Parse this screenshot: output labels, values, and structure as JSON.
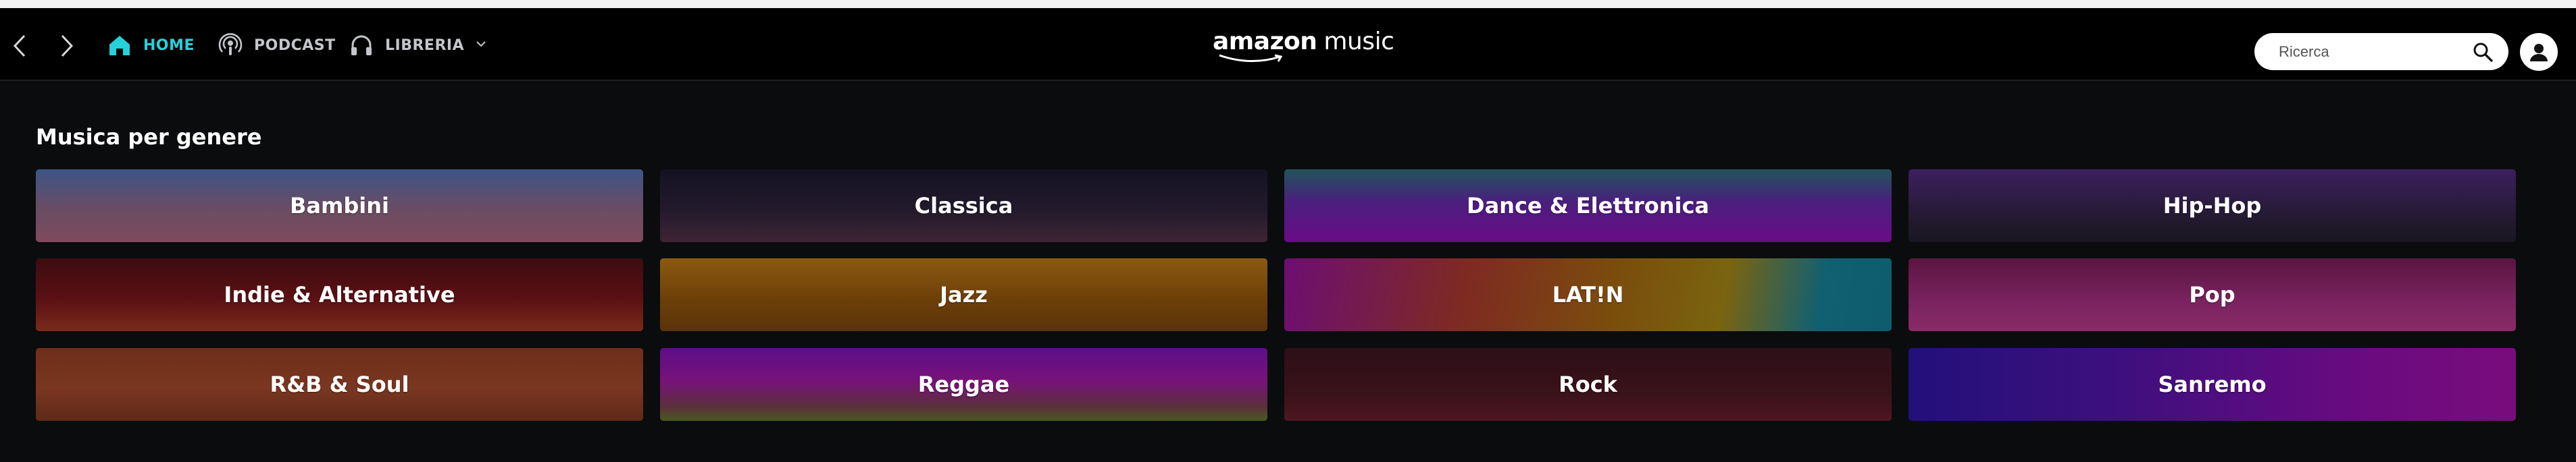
{
  "app": {
    "logo_text_left": "amazon",
    "logo_text_right": "music"
  },
  "nav": {
    "back_icon": "chevron-left-icon",
    "forward_icon": "chevron-right-icon",
    "items": [
      {
        "label": "HOME",
        "icon": "home-icon",
        "active": true
      },
      {
        "label": "PODCAST",
        "icon": "podcast-icon",
        "active": false
      },
      {
        "label": "LIBRERIA",
        "icon": "headphones-icon",
        "active": false
      }
    ]
  },
  "search": {
    "placeholder": "Ricerca",
    "value": "",
    "icon": "search-icon"
  },
  "profile": {
    "icon": "user-icon"
  },
  "section": {
    "title": "Musica per genere",
    "genres": [
      {
        "label": "Bambini"
      },
      {
        "label": "Classica"
      },
      {
        "label": "Dance & Elettronica"
      },
      {
        "label": "Hip-Hop"
      },
      {
        "label": "Indie & Alternative"
      },
      {
        "label": "Jazz"
      },
      {
        "label": "LAT!N"
      },
      {
        "label": "Pop"
      },
      {
        "label": "R&B & Soul"
      },
      {
        "label": "Reggae"
      },
      {
        "label": "Rock"
      },
      {
        "label": "Sanremo"
      }
    ]
  },
  "colors": {
    "accent": "#25d1da",
    "nav_text": "#c3c6ca",
    "background": "#0b0c0e"
  }
}
